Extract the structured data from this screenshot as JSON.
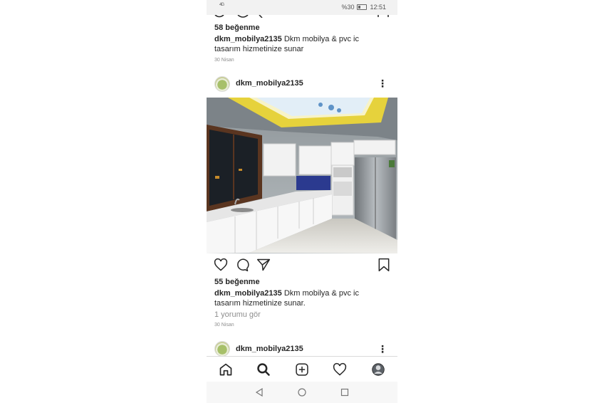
{
  "status_bar": {
    "signal": "4G",
    "battery": "%30",
    "time": "12:51"
  },
  "post1": {
    "likes": "58 beğenme",
    "username": "dkm_mobilya2135",
    "caption": "Dkm mobilya & pvc ic tasarım hizmetinize sunar",
    "date": "30 Nisan"
  },
  "post2": {
    "username": "dkm_mobilya2135",
    "likes": "55 beğenme",
    "caption_user": "dkm_mobilya2135",
    "caption": "Dkm mobilya & pvc ic tasarım hizmetinize sunar.",
    "comments": "1 yorumu gör",
    "date": "30 Nisan"
  },
  "post3": {
    "username": "dkm_mobilya2135"
  },
  "icons": {
    "actions": [
      "heart-icon",
      "comment-icon",
      "send-icon",
      "bookmark-icon"
    ],
    "nav": [
      "home-icon",
      "search-icon",
      "add-post-icon",
      "activity-heart-icon",
      "profile-avatar"
    ],
    "system": [
      "back-icon",
      "home-circle-icon",
      "recents-icon"
    ]
  }
}
